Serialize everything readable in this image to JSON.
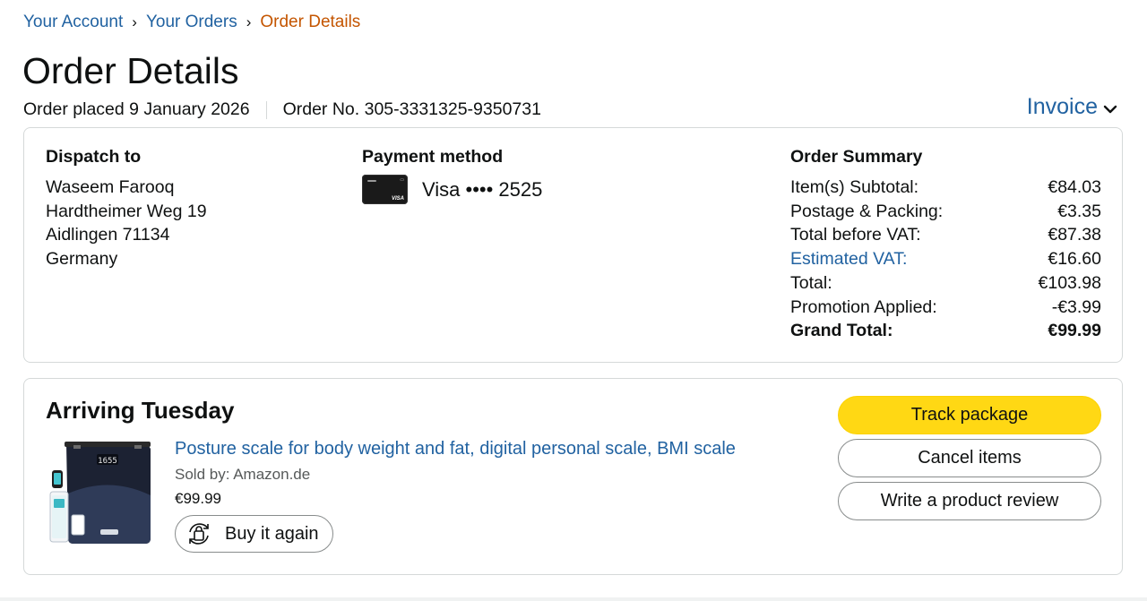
{
  "breadcrumb": {
    "items": [
      "Your Account",
      "Your Orders"
    ],
    "current": "Order Details",
    "separator": "›"
  },
  "page": {
    "title": "Order Details",
    "order_placed": "Order placed 9 January 2026",
    "order_number": "Order No. 305-3331325-9350731",
    "invoice_label": "Invoice"
  },
  "dispatch": {
    "title": "Dispatch to",
    "lines": [
      "Waseem Farooq",
      "Hardtheimer Weg 19",
      "Aidlingen 71134",
      "Germany"
    ]
  },
  "payment": {
    "title": "Payment method",
    "card_text": "Visa •••• 2525",
    "card_icon": "credit-card-icon"
  },
  "summary": {
    "title": "Order Summary",
    "rows": [
      {
        "label": "Item(s) Subtotal:",
        "value": "€84.03"
      },
      {
        "label": "Postage & Packing:",
        "value": "€3.35"
      },
      {
        "label": "Total before VAT:",
        "value": "€87.38"
      },
      {
        "label": "Estimated VAT:",
        "value": "€16.60"
      },
      {
        "label": "Total:",
        "value": "€103.98"
      },
      {
        "label": "Promotion Applied:",
        "value": "-€3.99"
      },
      {
        "label": "Grand Total:",
        "value": "€99.99"
      }
    ]
  },
  "shipment": {
    "status": "Arriving Tuesday",
    "product_title": "Posture scale for body weight and fat, digital personal scale, BMI scale",
    "sold_by": "Sold by: Amazon.de",
    "price": "€99.99",
    "buy_again_label": "Buy it again",
    "actions": {
      "track": "Track package",
      "cancel": "Cancel items",
      "review": "Write a product review"
    }
  },
  "colors": {
    "link": "#2162a1",
    "breadcrumb_current": "#c45500",
    "primary_button": "#ffd814",
    "border": "#d5d9d9"
  }
}
